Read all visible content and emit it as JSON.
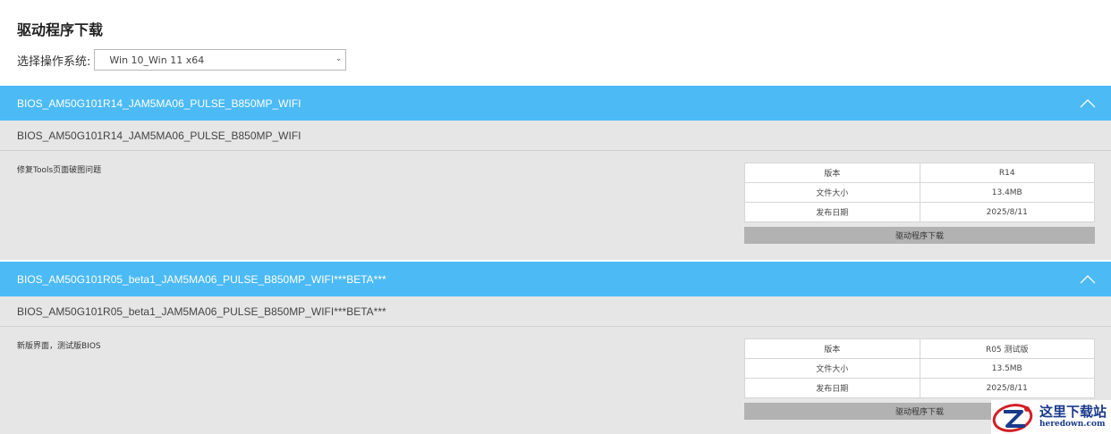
{
  "page": {
    "title": "驱动程序下载"
  },
  "os_selector": {
    "label": "选择操作系统:",
    "selected": "Win 10_Win 11 x64"
  },
  "sections": [
    {
      "header": "BIOS_AM50G101R14_JAM5MA06_PULSE_B850MP_WIFI",
      "subtitle": "BIOS_AM50G101R14_JAM5MA06_PULSE_B850MP_WIFI",
      "description": "修复Tools页面破图问题",
      "table": [
        {
          "key": "版本",
          "value": "R14"
        },
        {
          "key": "文件大小",
          "value": "13.4MB"
        },
        {
          "key": "发布日期",
          "value": "2025/8/11"
        }
      ],
      "download_label": "驱动程序下载"
    },
    {
      "header": "BIOS_AM50G101R05_beta1_JAM5MA06_PULSE_B850MP_WIFI***BETA***",
      "subtitle": "BIOS_AM50G101R05_beta1_JAM5MA06_PULSE_B850MP_WIFI***BETA***",
      "description": "新版界面，测试版BIOS",
      "table": [
        {
          "key": "版本",
          "value": "R05 测试版"
        },
        {
          "key": "文件大小",
          "value": "13.5MB"
        },
        {
          "key": "发布日期",
          "value": "2025/8/11"
        }
      ],
      "download_label": "驱动程序下载"
    }
  ],
  "watermark": {
    "text_cn": "这里下载站",
    "url": "heredown.com"
  },
  "colors": {
    "header_bg": "#4cbaf5",
    "section_bg": "#e6e6e6",
    "button_bg": "#b2b2b2"
  }
}
